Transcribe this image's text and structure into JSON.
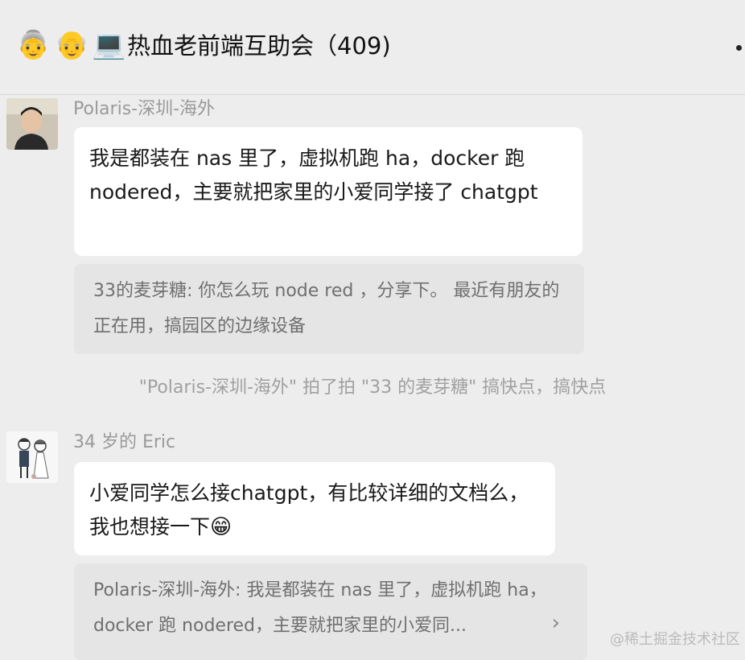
{
  "header": {
    "emoji_1": "👵",
    "emoji_2": "👴",
    "emoji_3": "💻",
    "title": "热血老前端互助会（409)"
  },
  "messages": [
    {
      "sender": "Polaris-深圳-海外",
      "text": "我是都装在 nas 里了，虚拟机跑 ha，docker 跑 nodered，主要就把家里的小爱同学接了 chatgpt",
      "quote": "33的麦芽糖: 你怎么玩 node red ，分享下。 最近有朋友的正在用，搞园区的边缘设备"
    },
    {
      "sender": "34 岁的 Eric",
      "text": "小爱同学怎么接chatgpt，有比较详细的文档么，我也想接一下",
      "emoji": "😁",
      "quote": "Polaris-深圳-海外: 我是都装在 nas 里了，虚拟机跑 ha，docker 跑 nodered，主要就把家里的小爱同...",
      "quote_arrow": "›"
    }
  ],
  "system_message": "\"Polaris-深圳-海外\" 拍了拍 \"33 的麦芽糖\" 搞快点，搞快点",
  "watermark": "@稀土掘金技术社区"
}
